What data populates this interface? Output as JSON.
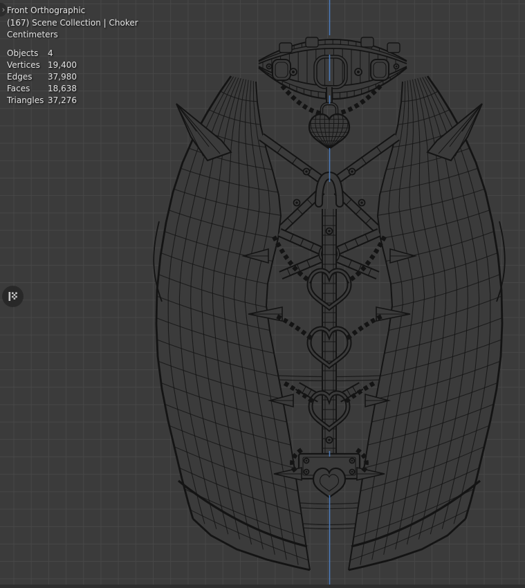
{
  "colors": {
    "bg": "#3b3b3b",
    "grid": "#474747",
    "wire": "#141414",
    "axis": "#4f7fc0",
    "text": "#e4e4e4"
  },
  "viewport": {
    "header": {
      "view": "Front Orthographic",
      "collection": "(167) Scene Collection | Choker",
      "units": "Centimeters"
    },
    "stats": {
      "rows": [
        {
          "label": "Objects",
          "value": "4"
        },
        {
          "label": "Vertices",
          "value": "19,400"
        },
        {
          "label": "Edges",
          "value": "37,980"
        },
        {
          "label": "Faces",
          "value": "18,638"
        },
        {
          "label": "Triangles",
          "value": "37,276"
        }
      ]
    }
  },
  "icons": {
    "chevron_right": "›"
  }
}
